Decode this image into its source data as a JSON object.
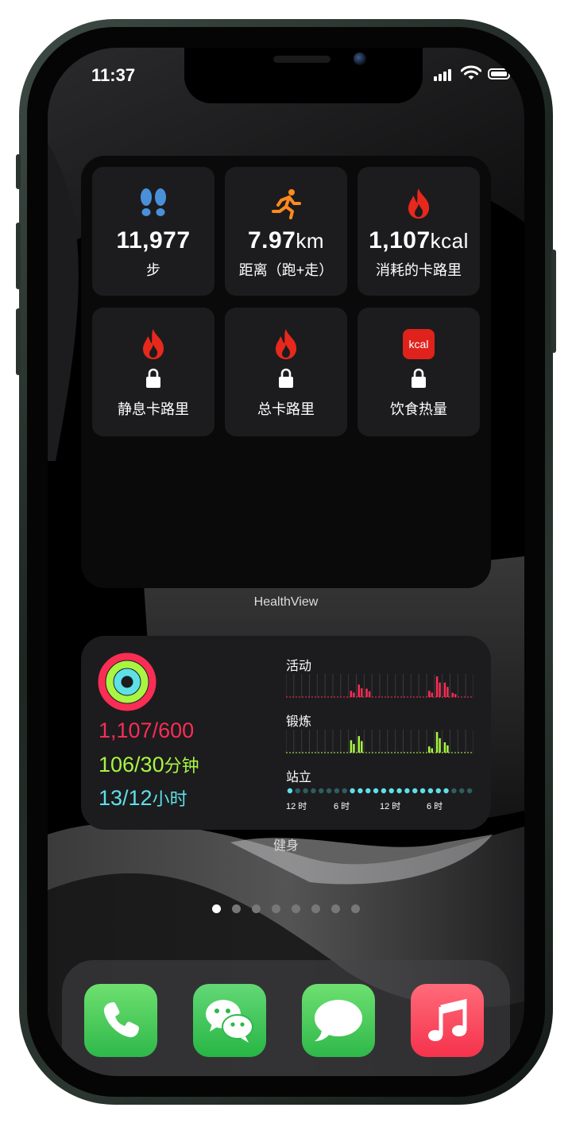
{
  "status_bar": {
    "time": "11:37"
  },
  "healthview": {
    "widget_label": "HealthView",
    "tiles": [
      {
        "icon": "footprints-icon",
        "value": "11,977",
        "unit": "",
        "label": "步",
        "locked": false
      },
      {
        "icon": "running-icon",
        "value": "7.97",
        "unit": "km",
        "label": "距离（跑+走）",
        "locked": false
      },
      {
        "icon": "flame-icon",
        "value": "1,107",
        "unit": "kcal",
        "label": "消耗的卡路里",
        "locked": false
      },
      {
        "icon": "flame-icon",
        "label": "静息卡路里",
        "locked": true
      },
      {
        "icon": "flame-icon",
        "label": "总卡路里",
        "locked": true
      },
      {
        "icon": "kcal-badge-icon",
        "badge": "kcal",
        "label": "饮食热量",
        "locked": true
      }
    ]
  },
  "fitness": {
    "widget_label": "健身",
    "move": "1,107/600",
    "exercise": "106/30",
    "exercise_unit": "分钟",
    "stand": "13/12",
    "stand_unit": "小时",
    "colors": {
      "move": "#fa2d55",
      "exercise": "#a8f542",
      "stand": "#5ee0e8"
    },
    "rings": {
      "move": 1.0,
      "exercise": 1.0,
      "stand": 1.0
    }
  },
  "chart_data": [
    {
      "type": "bar",
      "title": "活动",
      "x_ticks": [
        "12 时",
        "6 时",
        "12 时",
        "6 时"
      ],
      "hours": 24,
      "values": [
        0,
        0,
        0,
        0,
        0,
        0,
        0,
        0,
        0.3,
        0.6,
        0.4,
        0,
        0,
        0,
        0,
        0,
        0,
        0,
        0.3,
        1.0,
        0.7,
        0.2,
        0,
        0
      ],
      "color": "#fa2d55"
    },
    {
      "type": "bar",
      "title": "锻炼",
      "x_ticks": [
        "12 时",
        "6 时",
        "12 时",
        "6 时"
      ],
      "hours": 24,
      "values": [
        0,
        0,
        0,
        0,
        0,
        0,
        0,
        0,
        0.6,
        0.8,
        0,
        0,
        0,
        0,
        0,
        0,
        0,
        0,
        0.3,
        1.0,
        0.5,
        0,
        0,
        0
      ],
      "color": "#a8f542"
    },
    {
      "type": "scatter",
      "title": "站立",
      "x_ticks": [
        "12 时",
        "6 时",
        "12 时",
        "6 时"
      ],
      "hours": 24,
      "values": [
        1,
        0,
        0,
        0,
        0,
        0,
        0,
        0,
        1,
        1,
        1,
        1,
        1,
        1,
        1,
        1,
        1,
        1,
        1,
        1,
        1,
        0,
        0,
        0
      ],
      "color": "#5ee0e8"
    }
  ],
  "page_dots": {
    "count": 8,
    "active": 0
  },
  "dock": [
    {
      "name": "phone",
      "color": "#34c759"
    },
    {
      "name": "wechat",
      "color": "#2dc84d"
    },
    {
      "name": "messages",
      "color": "#34c759"
    },
    {
      "name": "music",
      "color": "#fc3c44"
    }
  ]
}
